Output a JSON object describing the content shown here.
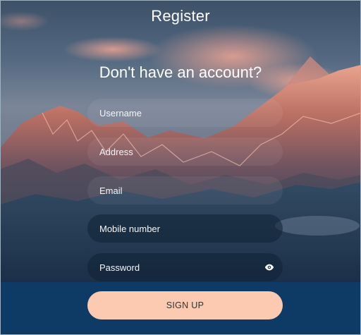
{
  "page": {
    "title": "Register",
    "subtitle": "Don't have an account?"
  },
  "form": {
    "username_placeholder": "Username",
    "address_placeholder": "Address",
    "email_placeholder": "Email",
    "mobile_placeholder": "Mobile number",
    "password_placeholder": "Password",
    "password_toggle_icon": "eye-icon",
    "submit_label": "SIGN UP"
  },
  "colors": {
    "button_bg": "#fccab1",
    "bottom_band": "#0e3a66",
    "text": "#ffffff"
  }
}
